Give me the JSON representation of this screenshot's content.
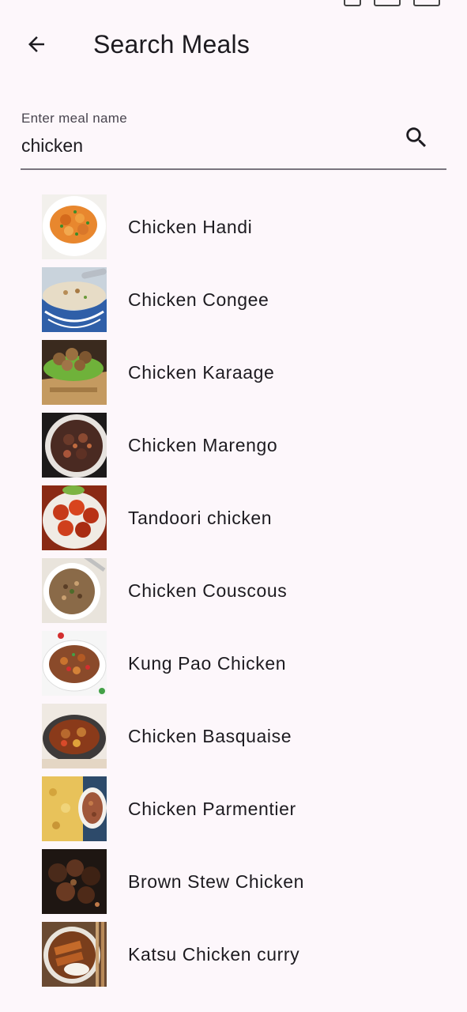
{
  "app_bar": {
    "title": "Search Meals",
    "back_icon": "arrow-back-icon"
  },
  "search": {
    "label": "Enter meal name",
    "value": "chicken",
    "search_icon": "search-icon"
  },
  "meals": [
    {
      "name": "Chicken Handi"
    },
    {
      "name": "Chicken Congee"
    },
    {
      "name": "Chicken Karaage"
    },
    {
      "name": "Chicken Marengo"
    },
    {
      "name": "Tandoori chicken"
    },
    {
      "name": "Chicken Couscous"
    },
    {
      "name": "Kung Pao Chicken"
    },
    {
      "name": "Chicken Basquaise"
    },
    {
      "name": "Chicken Parmentier"
    },
    {
      "name": "Brown Stew Chicken"
    },
    {
      "name": "Katsu Chicken curry"
    }
  ],
  "colors": {
    "background": "#fdf7fb",
    "text": "#1d1b20",
    "label": "#49454f",
    "underline": "#79747e"
  }
}
